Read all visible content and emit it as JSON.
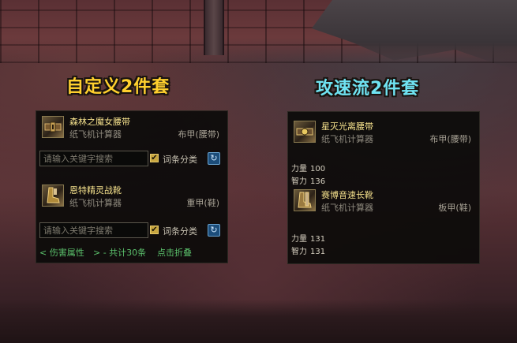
{
  "headings": {
    "left": "自定义2件套",
    "right": "攻速流2件套"
  },
  "left_panel": {
    "item1": {
      "name": "森林之魔女腰带",
      "source": "纸飞机计算器",
      "type": "布甲(腰带)",
      "icon": "belt-icon"
    },
    "search1": {
      "placeholder": "请输入关键字搜索",
      "checkbox_label": "词条分类",
      "checked": true
    },
    "item2": {
      "name": "恩特精灵战靴",
      "source": "纸飞机计算器",
      "type": "重甲(鞋)",
      "icon": "boots-icon"
    },
    "search2": {
      "placeholder": "请输入关键字搜索",
      "checkbox_label": "词条分类",
      "checked": true
    },
    "footer": {
      "back": "< 伤害属性",
      "next": "> - 共计30条",
      "fold": "点击折叠"
    }
  },
  "right_panel": {
    "item1": {
      "name": "星灭光离腰带",
      "source": "纸飞机计算器",
      "type": "布甲(腰带)",
      "icon": "belt-icon"
    },
    "item1_stats": [
      {
        "label": "力量",
        "value": "100"
      },
      {
        "label": "智力",
        "value": "136"
      }
    ],
    "item2": {
      "name": "赛博音速长靴",
      "source": "纸飞机计算器",
      "type": "板甲(鞋)",
      "icon": "boots-icon"
    },
    "item2_stats": [
      {
        "label": "力量",
        "value": "131"
      },
      {
        "label": "智力",
        "value": "131"
      }
    ]
  },
  "colors": {
    "left_heading": "#ffd02e",
    "right_heading": "#6fe3f2",
    "item_name": "#f4e08c",
    "footer_link": "#5bc16c"
  }
}
